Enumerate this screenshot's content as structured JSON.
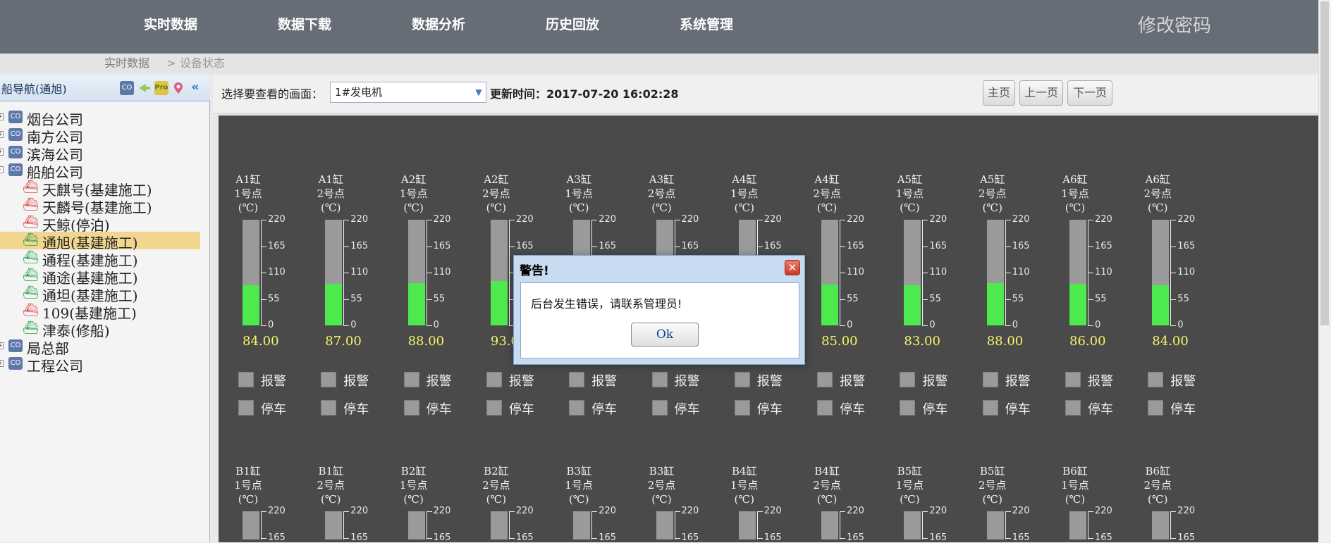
{
  "nav": {
    "items": [
      "实时数据",
      "数据下载",
      "数据分析",
      "历史回放",
      "系统管理"
    ],
    "change_password": "修改密码"
  },
  "breadcrumb": {
    "root": "实时数据",
    "separator": ">",
    "current": "设备状态"
  },
  "sidebar": {
    "title": "船导航(通旭)",
    "tool_icons": [
      "co-icon",
      "arrow-icon",
      "pro-icon",
      "location-pin-icon",
      "collapse-icon"
    ],
    "tree": [
      {
        "label": "烟台公司",
        "level": 0,
        "expander": "+",
        "icon": "CO"
      },
      {
        "label": "南方公司",
        "level": 0,
        "expander": "+",
        "icon": "CO"
      },
      {
        "label": "滨海公司",
        "level": 0,
        "expander": "+",
        "icon": "CO"
      },
      {
        "label": "船舶公司",
        "level": 0,
        "expander": "-",
        "icon": "CO"
      },
      {
        "label": "天麒号(基建施工)",
        "level": 1,
        "icon": "ship",
        "status": "red"
      },
      {
        "label": "天麟号(基建施工)",
        "level": 1,
        "icon": "ship",
        "status": "red"
      },
      {
        "label": "天鲸(停泊)",
        "level": 1,
        "icon": "ship",
        "status": "red"
      },
      {
        "label": "通旭(基建施工)",
        "level": 1,
        "icon": "ship",
        "status": "green",
        "selected": true
      },
      {
        "label": "通程(基建施工)",
        "level": 1,
        "icon": "ship",
        "status": "green"
      },
      {
        "label": "通途(基建施工)",
        "level": 1,
        "icon": "ship",
        "status": "green"
      },
      {
        "label": "通坦(基建施工)",
        "level": 1,
        "icon": "ship",
        "status": "green"
      },
      {
        "label": "109(基建施工)",
        "level": 1,
        "icon": "ship",
        "status": "red"
      },
      {
        "label": "津泰(修船)",
        "level": 1,
        "icon": "ship",
        "status": "green"
      },
      {
        "label": "局总部",
        "level": 0,
        "expander": "+",
        "icon": "CO"
      },
      {
        "label": "工程公司",
        "level": 0,
        "expander": "+",
        "icon": "CO"
      }
    ]
  },
  "toolbar": {
    "select_label": "选择要查看的画面：",
    "select_value": "1#发电机",
    "update_label": "更新时间：2017-07-20 16:02:28",
    "buttons": [
      "主页",
      "上一页",
      "下一页"
    ]
  },
  "gauges": {
    "scale_max": 220,
    "ticks": [
      "220",
      "165",
      "110",
      "55",
      "0"
    ],
    "alarm_label": "报警",
    "stop_label": "停车",
    "row1": [
      {
        "title": "A1缸",
        "point": "1号点",
        "unit": "(℃)",
        "value": "84.00"
      },
      {
        "title": "A1缸",
        "point": "2号点",
        "unit": "(℃)",
        "value": "87.00"
      },
      {
        "title": "A2缸",
        "point": "1号点",
        "unit": "(℃)",
        "value": "88.00"
      },
      {
        "title": "A2缸",
        "point": "2号点",
        "unit": "(℃)",
        "value": "93.00"
      },
      {
        "title": "A3缸",
        "point": "1号点",
        "unit": "(℃)",
        "value": ""
      },
      {
        "title": "A3缸",
        "point": "2号点",
        "unit": "(℃)",
        "value": ""
      },
      {
        "title": "A4缸",
        "point": "1号点",
        "unit": "(℃)",
        "value": ""
      },
      {
        "title": "A4缸",
        "point": "2号点",
        "unit": "(℃)",
        "value": "85.00"
      },
      {
        "title": "A5缸",
        "point": "1号点",
        "unit": "(℃)",
        "value": "83.00"
      },
      {
        "title": "A5缸",
        "point": "2号点",
        "unit": "(℃)",
        "value": "88.00"
      },
      {
        "title": "A6缸",
        "point": "1号点",
        "unit": "(℃)",
        "value": "86.00"
      },
      {
        "title": "A6缸",
        "point": "2号点",
        "unit": "(℃)",
        "value": "84.00"
      }
    ],
    "row2": [
      {
        "title": "B1缸",
        "point": "1号点",
        "unit": "(℃)"
      },
      {
        "title": "B1缸",
        "point": "2号点",
        "unit": "(℃)"
      },
      {
        "title": "B2缸",
        "point": "1号点",
        "unit": "(℃)"
      },
      {
        "title": "B2缸",
        "point": "2号点",
        "unit": "(℃)"
      },
      {
        "title": "B3缸",
        "point": "1号点",
        "unit": "(℃)"
      },
      {
        "title": "B3缸",
        "point": "2号点",
        "unit": "(℃)"
      },
      {
        "title": "B4缸",
        "point": "1号点",
        "unit": "(℃)"
      },
      {
        "title": "B4缸",
        "point": "2号点",
        "unit": "(℃)"
      },
      {
        "title": "B5缸",
        "point": "1号点",
        "unit": "(℃)"
      },
      {
        "title": "B5缸",
        "point": "2号点",
        "unit": "(℃)"
      },
      {
        "title": "B6缸",
        "point": "1号点",
        "unit": "(℃)"
      },
      {
        "title": "B6缸",
        "point": "2号点",
        "unit": "(℃)"
      }
    ]
  },
  "dialog": {
    "title": "警告!",
    "message": "后台发生错误，请联系管理员!",
    "ok_label": "Ok",
    "close_glyph": "✕"
  },
  "colors": {
    "nav_bg": "#676d77",
    "panel_bg": "#4a4a4a",
    "gauge_fill": "#4dea4d",
    "value_text": "#f3f36b",
    "selected_row": "#f2d58e"
  }
}
